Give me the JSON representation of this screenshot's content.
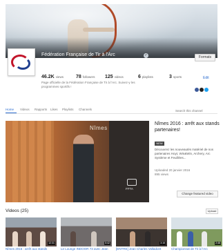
{
  "channel": {
    "title": "Fédération Française de Tir à l'Arc",
    "subscribe_label": "Formats",
    "description": "Page officielle de la Fédération Française de Tir à l'Arc. Suivez-y les programmes sportifs !",
    "edit_label": "Edit",
    "stats": [
      {
        "value": "46.2K",
        "label": "views"
      },
      {
        "value": "78",
        "label": "followers"
      },
      {
        "value": "125",
        "label": "videos"
      },
      {
        "value": "6",
        "label": "playlists"
      },
      {
        "value": "3",
        "label": "sports"
      }
    ],
    "social_icon_colors": [
      "#3b5998",
      "#222222",
      "#1da1f2"
    ]
  },
  "tabs": {
    "items": [
      "Home",
      "Videos",
      "Rapports",
      "Likes",
      "Playlists",
      "Channels"
    ],
    "active": "Home",
    "search_placeholder": "Search this channel"
  },
  "featured": {
    "overlay_text": "Nîmes",
    "watermark": "FFTA",
    "title": "Nîmes 2016 : arrêt aux stands partenaires!",
    "badge": "NEW",
    "description": "Découvrez les nouveautés matériel de nos partenaires Hoyt, Win&Win, Archery, Arc Système et Feuillées...",
    "published": "Uploaded 20 janvier 2016",
    "views": "895 views",
    "change_trailer_label": "Change featured video"
  },
  "videos": {
    "section_title": "Videos (25)",
    "upload_label": "Upload",
    "items": [
      {
        "title": "Nîmes 2016 : arrêt aux stands",
        "duration": "12:31"
      },
      {
        "title": "Le Lounge INDOOR 73 avec Jean",
        "duration": "5:42"
      },
      {
        "title": "[ENTRE] Jean Charles Valladont",
        "duration": "3:15"
      },
      {
        "title": "Championnat de Tir à l'Arc",
        "duration": "2:48"
      }
    ]
  },
  "colors": {
    "link": "#2b6ccf",
    "logo_red": "#c2152a",
    "logo_blue": "#1f3f8f"
  }
}
